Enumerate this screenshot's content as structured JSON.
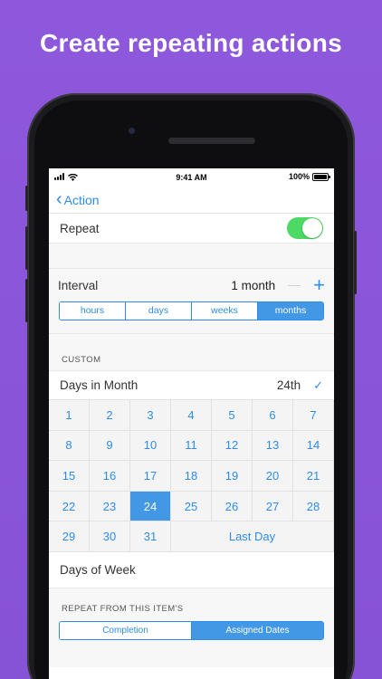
{
  "headline": "Create repeating actions",
  "status": {
    "time": "9:41 AM",
    "battery": "100%"
  },
  "nav": {
    "back_label": "Action"
  },
  "repeat": {
    "label": "Repeat",
    "enabled": true,
    "toggle_color": "#4cd964"
  },
  "interval": {
    "label": "Interval",
    "value": "1 month",
    "units": [
      "hours",
      "days",
      "weeks",
      "months"
    ],
    "selected": "months"
  },
  "custom": {
    "header": "CUSTOM",
    "days_in_month_label": "Days in Month",
    "days_in_month_value": "24th",
    "selected_day": 24,
    "days": [
      "1",
      "2",
      "3",
      "4",
      "5",
      "6",
      "7",
      "8",
      "9",
      "10",
      "11",
      "12",
      "13",
      "14",
      "15",
      "16",
      "17",
      "18",
      "19",
      "20",
      "21",
      "22",
      "23",
      "24",
      "25",
      "26",
      "27",
      "28",
      "29",
      "30",
      "31"
    ],
    "last_day_label": "Last Day"
  },
  "days_of_week_label": "Days of Week",
  "repeat_from": {
    "header": "REPEAT FROM THIS ITEM'S",
    "options": [
      "Completion",
      "Assigned Dates"
    ],
    "selected": "Assigned Dates"
  },
  "colors": {
    "accent": "#2d8ceb",
    "selected_fill": "#4398e6",
    "background": "#8a57d6"
  }
}
